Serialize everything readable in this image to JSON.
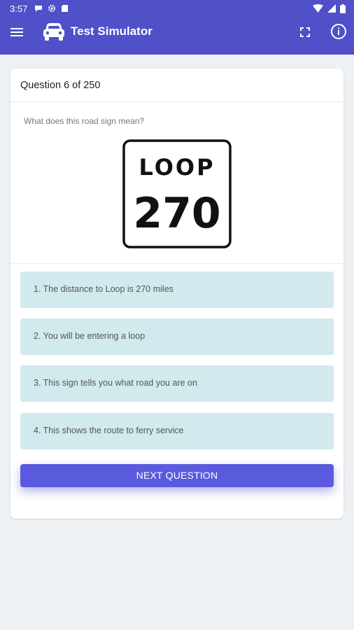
{
  "status_bar": {
    "time": "3:57"
  },
  "app_bar": {
    "title": "Test Simulator"
  },
  "quiz": {
    "progress_label": "Question 6 of 250",
    "question": "What does this road sign mean?",
    "sign": {
      "line1": "LOOP",
      "line2": "270"
    },
    "answers": [
      {
        "label": "1. The distance to Loop is 270 miles"
      },
      {
        "label": "2. You will be entering a loop"
      },
      {
        "label": "3. This sign tells you what road you are on"
      },
      {
        "label": "4. This shows the route to ferry service"
      }
    ],
    "next_label": "NEXT QUESTION"
  },
  "colors": {
    "primary": "#5050c8",
    "answer_bg": "#d2e9ee",
    "button": "#5a5ade",
    "background": "#eef1f3"
  }
}
